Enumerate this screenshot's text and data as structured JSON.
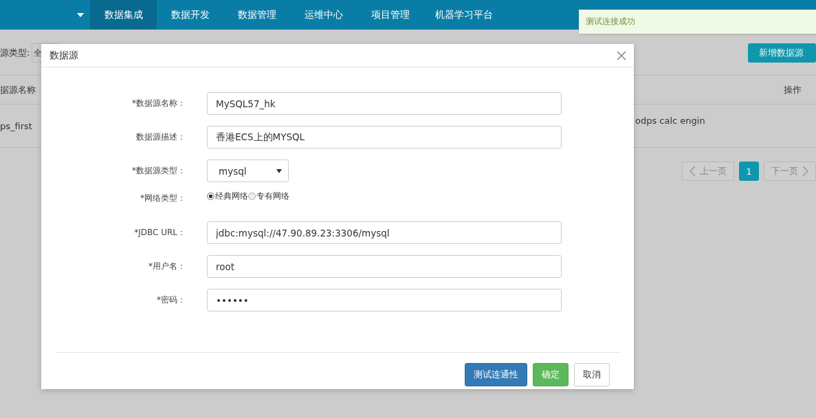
{
  "nav": {
    "items": [
      {
        "label": "数据集成",
        "selected": true
      },
      {
        "label": "数据开发",
        "selected": false
      },
      {
        "label": "数据管理",
        "selected": false
      },
      {
        "label": "运维中心",
        "selected": false
      },
      {
        "label": "项目管理",
        "selected": false
      },
      {
        "label": "机器学习平台",
        "selected": false
      }
    ]
  },
  "background": {
    "filter_label": "源类型:",
    "filter_select": "全",
    "add_button": "新增数据源",
    "table": {
      "columns": [
        "据源名称",
        "操作"
      ],
      "rows": [
        {
          "column_1": "ps_first",
          "column_2": "odps calc engin"
        }
      ]
    },
    "pagination": {
      "prev": "上一页",
      "pages": [
        {
          "label": "1",
          "selected": true
        }
      ],
      "next": "下一页"
    }
  },
  "toast": {
    "message": "测试连接成功"
  },
  "dialog": {
    "title": "数据源",
    "fields": [
      {
        "kind": "text",
        "label": "*数据源名称：",
        "value": "MySQL57_hk"
      },
      {
        "kind": "text",
        "label": "数据源描述：",
        "value": "香港ECS上的MYSQL"
      },
      {
        "kind": "select",
        "label": "*数据源类型：",
        "value": "mysql"
      },
      {
        "kind": "radio",
        "label": "*网络类型：",
        "options": [
          {
            "label": "经典网络",
            "selected": true
          },
          {
            "label": "专有网络",
            "selected": false
          }
        ]
      },
      {
        "kind": "text",
        "label": "*JDBC URL：",
        "value": "jdbc:mysql://47.90.89.23:3306/mysql"
      },
      {
        "kind": "text",
        "label": "*用户名：",
        "value": "root"
      },
      {
        "kind": "text",
        "label": "*密码：",
        "value": "••••••"
      }
    ],
    "buttons": [
      {
        "label": "测试连通性",
        "kind": "primary"
      },
      {
        "label": "确定",
        "kind": "success"
      },
      {
        "label": "取消",
        "kind": "default"
      }
    ]
  }
}
